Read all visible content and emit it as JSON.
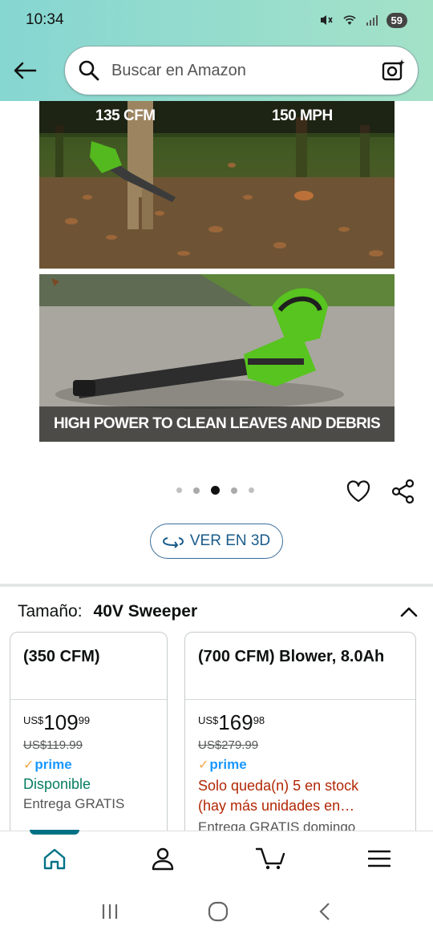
{
  "status_bar": {
    "time": "10:34",
    "battery": "59"
  },
  "search": {
    "placeholder": "Buscar en Amazon"
  },
  "gallery": {
    "image1_left_label": "135 CFM",
    "image1_right_label": "150 MPH",
    "image2_caption": "HIGH POWER TO CLEAN LEAVES AND DEBRIS",
    "dots_count": 5,
    "active_dot": 3
  },
  "view3d": {
    "label": "VER EN 3D"
  },
  "size_selector": {
    "label": "Tamaño:",
    "value": "40V Sweeper"
  },
  "options": [
    {
      "title": "(350 CFM)",
      "currency": "US$",
      "price_whole": "109",
      "price_fraction": "99",
      "list_price": "US$119.99",
      "prime": "prime",
      "availability": "Disponible",
      "shipping": "Entrega GRATIS"
    },
    {
      "title": "(700 CFM) Blower, 8.0Ah",
      "currency": "US$",
      "price_whole": "169",
      "price_fraction": "98",
      "list_price": "US$279.99",
      "prime": "prime",
      "stock_line1": "Solo queda(n) 5 en stock",
      "stock_line2": "(hay más unidades en…",
      "shipping": "Entrega GRATIS domingo"
    }
  ],
  "colors": {
    "header_bg": "#8fdbd0",
    "accent": "#007185",
    "prime_blue": "#1a98ff",
    "availability_green": "#067d62",
    "stock_red": "#b12704"
  }
}
